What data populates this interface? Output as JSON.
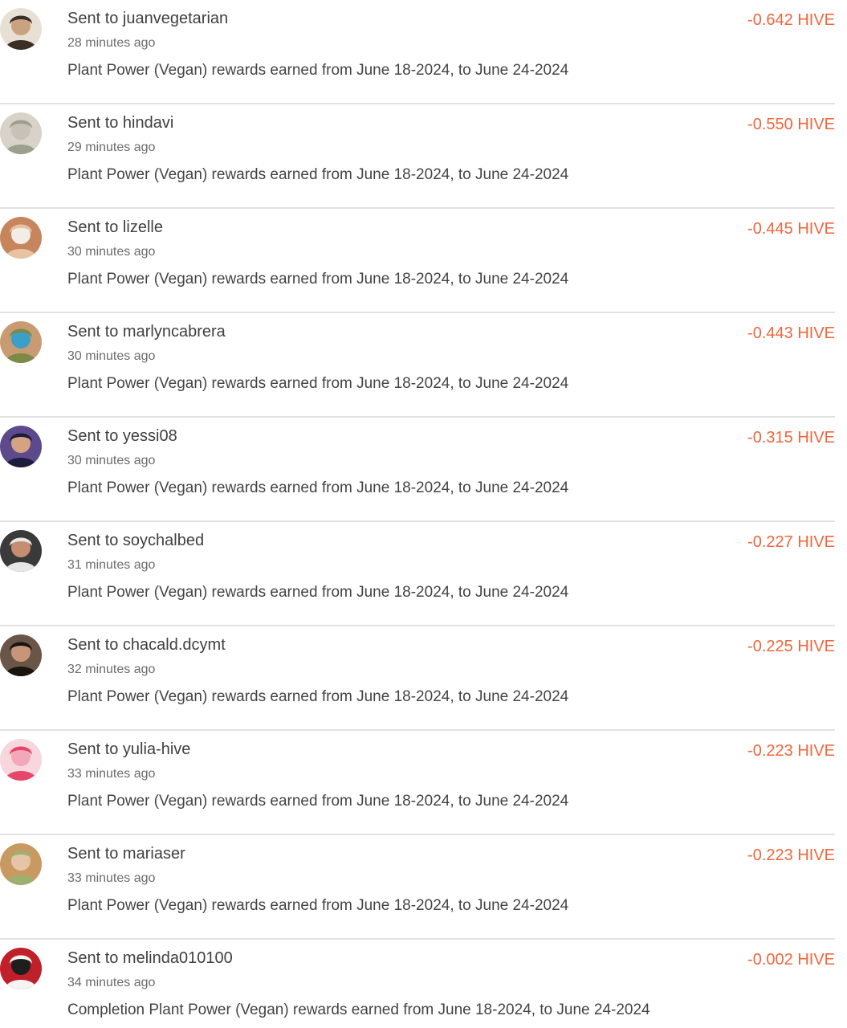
{
  "accent_color": "#f0663c",
  "transactions": [
    {
      "title": "Sent to juanvegetarian",
      "time": "28 minutes ago",
      "memo": "Plant Power (Vegan) rewards earned from June 18-2024, to June 24-2024",
      "amount": "-0.642 HIVE",
      "avatar_colors": [
        "#3b2e24",
        "#c9a27e",
        "#e8e0d4"
      ]
    },
    {
      "title": "Sent to hindavi",
      "time": "29 minutes ago",
      "memo": "Plant Power (Vegan) rewards earned from June 18-2024, to June 24-2024",
      "amount": "-0.550 HIVE",
      "avatar_colors": [
        "#9aa08c",
        "#c8c2b6",
        "#d8d2c8"
      ]
    },
    {
      "title": "Sent to lizelle",
      "time": "30 minutes ago",
      "memo": "Plant Power (Vegan) rewards earned from June 18-2024, to June 24-2024",
      "amount": "-0.445 HIVE",
      "avatar_colors": [
        "#e9c2a4",
        "#f2ede6",
        "#c7855e"
      ]
    },
    {
      "title": "Sent to marlyncabrera",
      "time": "30 minutes ago",
      "memo": "Plant Power (Vegan) rewards earned from June 18-2024, to June 24-2024",
      "amount": "-0.443 HIVE",
      "avatar_colors": [
        "#7d8a46",
        "#3aa0c8",
        "#c99b73"
      ]
    },
    {
      "title": "Sent to yessi08",
      "time": "30 minutes ago",
      "memo": "Plant Power (Vegan) rewards earned from June 18-2024, to June 24-2024",
      "amount": "-0.315 HIVE",
      "avatar_colors": [
        "#1c1c3c",
        "#d5a282",
        "#5c4a8c"
      ]
    },
    {
      "title": "Sent to soychalbed",
      "time": "31 minutes ago",
      "memo": "Plant Power (Vegan) rewards earned from June 18-2024, to June 24-2024",
      "amount": "-0.227 HIVE",
      "avatar_colors": [
        "#e6e6e6",
        "#c58e70",
        "#3a3a3a"
      ]
    },
    {
      "title": "Sent to chacald.dcymt",
      "time": "32 minutes ago",
      "memo": "Plant Power (Vegan) rewards earned from June 18-2024, to June 24-2024",
      "amount": "-0.225 HIVE",
      "avatar_colors": [
        "#1a1410",
        "#c79678",
        "#6a5648"
      ]
    },
    {
      "title": "Sent to yulia-hive",
      "time": "33 minutes ago",
      "memo": "Plant Power (Vegan) rewards earned from June 18-2024, to June 24-2024",
      "amount": "-0.223 HIVE",
      "avatar_colors": [
        "#e7466a",
        "#f2a8b8",
        "#f7d6de"
      ]
    },
    {
      "title": "Sent to mariaser",
      "time": "33 minutes ago",
      "memo": "Plant Power (Vegan) rewards earned from June 18-2024, to June 24-2024",
      "amount": "-0.223 HIVE",
      "avatar_colors": [
        "#9cb070",
        "#e8c4a6",
        "#c89a62"
      ]
    },
    {
      "title": "Sent to melinda010100",
      "time": "34 minutes ago",
      "memo": "Completion Plant Power (Vegan) rewards earned from June 18-2024, to June 24-2024",
      "amount": "-0.002 HIVE",
      "avatar_colors": [
        "#f4f4f4",
        "#1e1e1e",
        "#c0202a"
      ]
    }
  ]
}
